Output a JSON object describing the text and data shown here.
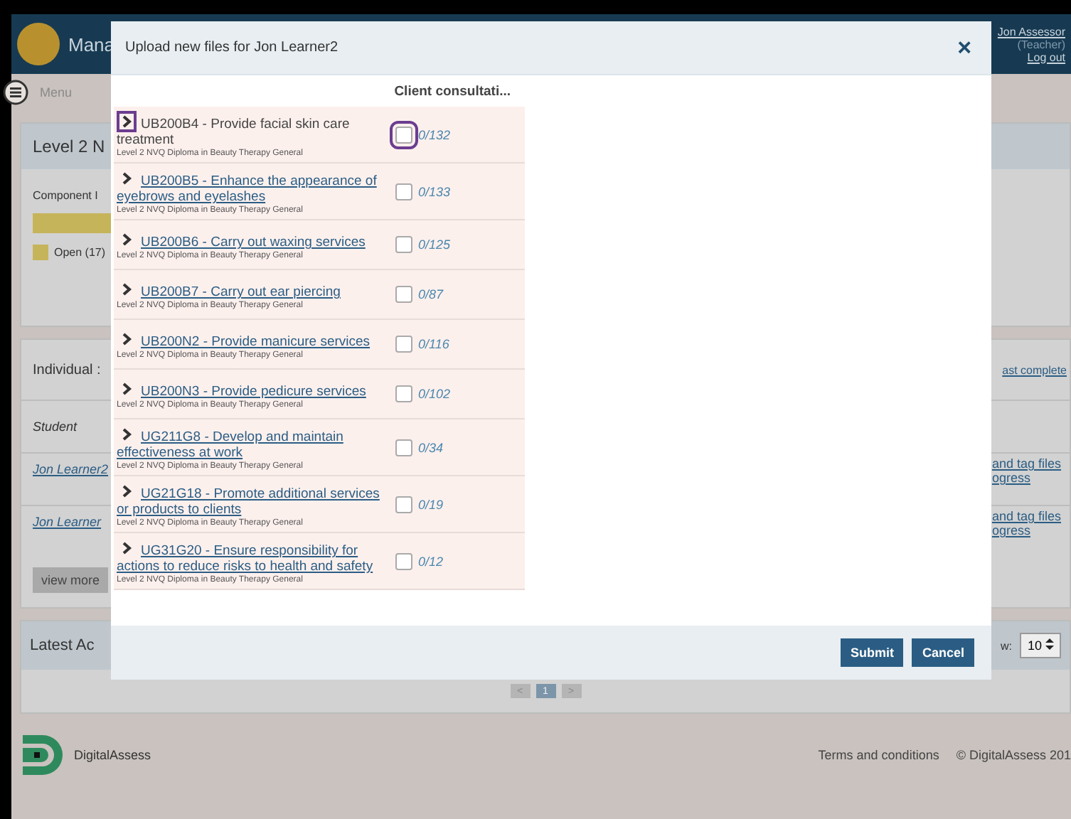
{
  "app_header": {
    "title": "Mana",
    "user": "Jon Assessor",
    "role": "(Teacher)",
    "logout": "Log out"
  },
  "menu": {
    "label": "Menu"
  },
  "panel": {
    "title": "Level 2 N",
    "component_label": "Component I",
    "legend": "Open (17)"
  },
  "individual": {
    "title": "Individual :",
    "right_link": "ast complete",
    "column_1": "Student",
    "rows": [
      {
        "name": "Jon Learner2",
        "action_1": "and tag files",
        "action_2": "ogress"
      },
      {
        "name": "Jon Learner",
        "action_1": "and tag files",
        "action_2": "ogress"
      }
    ],
    "view_more": "view more"
  },
  "latest": {
    "title": "Latest Ac",
    "show_label": "w:",
    "show_value": "10"
  },
  "pagination": [
    {
      "label": "<",
      "selected": false
    },
    {
      "label": "1",
      "selected": true
    },
    {
      "label": ">",
      "selected": false
    }
  ],
  "footer": {
    "brand": "DigitalAssess",
    "terms": "Terms and conditions",
    "copyright": "© DigitalAssess 201"
  },
  "modal": {
    "title": "Upload new files for Jon Learner2",
    "close": "×",
    "column_header": "Client consultati...",
    "rows": [
      {
        "unit": "UB200B4 - Provide facial skin care treatment",
        "qualification": "Level 2 NVQ Diploma in Beauty Therapy General",
        "count": "0/132",
        "checked": false,
        "highlighted": true
      },
      {
        "unit": "UB200B5 - Enhance the appearance of eyebrows and eyelashes",
        "qualification": "Level 2 NVQ Diploma in Beauty Therapy General",
        "count": "0/133",
        "checked": false,
        "highlighted": false
      },
      {
        "unit": "UB200B6 - Carry out waxing services",
        "qualification": "Level 2 NVQ Diploma in Beauty Therapy General",
        "count": "0/125",
        "checked": false,
        "highlighted": false
      },
      {
        "unit": "UB200B7 - Carry out ear piercing",
        "qualification": "Level 2 NVQ Diploma in Beauty Therapy General",
        "count": "0/87",
        "checked": false,
        "highlighted": false
      },
      {
        "unit": "UB200N2 - Provide manicure services",
        "qualification": "Level 2 NVQ Diploma in Beauty Therapy General",
        "count": "0/116",
        "checked": false,
        "highlighted": false
      },
      {
        "unit": "UB200N3 - Provide pedicure services",
        "qualification": "Level 2 NVQ Diploma in Beauty Therapy General",
        "count": "0/102",
        "checked": false,
        "highlighted": false
      },
      {
        "unit": "UG211G8 - Develop and maintain effectiveness at work",
        "qualification": "Level 2 NVQ Diploma in Beauty Therapy General",
        "count": "0/34",
        "checked": false,
        "highlighted": false
      },
      {
        "unit": "UG21G18 - Promote additional services or products to clients",
        "qualification": "Level 2 NVQ Diploma in Beauty Therapy General",
        "count": "0/19",
        "checked": false,
        "highlighted": false
      },
      {
        "unit": "UG31G20 - Ensure responsibility for actions to reduce risks to health and safety",
        "qualification": "Level 2 NVQ Diploma in Beauty Therapy General",
        "count": "0/12",
        "checked": false,
        "highlighted": false
      }
    ],
    "buttons": [
      "Submit",
      "Cancel"
    ]
  }
}
